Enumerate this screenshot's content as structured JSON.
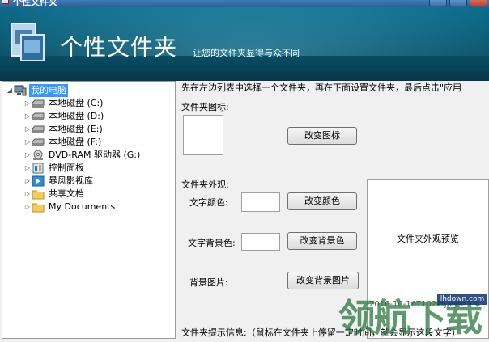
{
  "window": {
    "title": "个性文件夹"
  },
  "header": {
    "title": "个性文件夹",
    "subtitle": "让您的文件夹显得与众不同"
  },
  "tree": {
    "items": [
      {
        "label": "我的电脑",
        "icon": "computer-icon",
        "expanded": true,
        "selected": true
      },
      {
        "label": "本地磁盘 (C:)",
        "icon": "drive-icon"
      },
      {
        "label": "本地磁盘 (D:)",
        "icon": "drive-icon"
      },
      {
        "label": "本地磁盘 (E:)",
        "icon": "drive-icon"
      },
      {
        "label": "本地磁盘 (F:)",
        "icon": "drive-icon"
      },
      {
        "label": "DVD-RAM 驱动器 (G:)",
        "icon": "dvd-icon"
      },
      {
        "label": "控制面板",
        "icon": "control-panel-icon"
      },
      {
        "label": "暴风影视库",
        "icon": "media-library-icon"
      },
      {
        "label": "共享文档",
        "icon": "folder-icon"
      },
      {
        "label": "My Documents",
        "icon": "folder-icon"
      }
    ]
  },
  "panel": {
    "instruction": "先在左边列表中选择一个文件夹，再在下面设置文件夹，最后点击\"应用",
    "icon_label": "文件夹图标:",
    "change_icon_button": "改变图标",
    "appearance_label": "文件夹外观:",
    "text_color_label": "文字颜色:",
    "change_color_button": "改变颜色",
    "text_bg_color_label": "文字背景色:",
    "change_bg_color_button": "改变背景色",
    "bg_image_label": "背景图片:",
    "change_bg_image_button": "改变背景图片",
    "preview_label": "文件夹外观预览",
    "preview_file": "2016-10-16T1022.jpg 1",
    "tooltip_label": "文件夹提示信息:（鼠标在文件夹上停留一定时间，就会显示这段文字）"
  },
  "watermark": {
    "text": "领航下载",
    "url": "lhdown.com"
  },
  "colors": {
    "banner": "#09546d",
    "selection": "#3399ff",
    "titlebar": "#2b5f97"
  }
}
